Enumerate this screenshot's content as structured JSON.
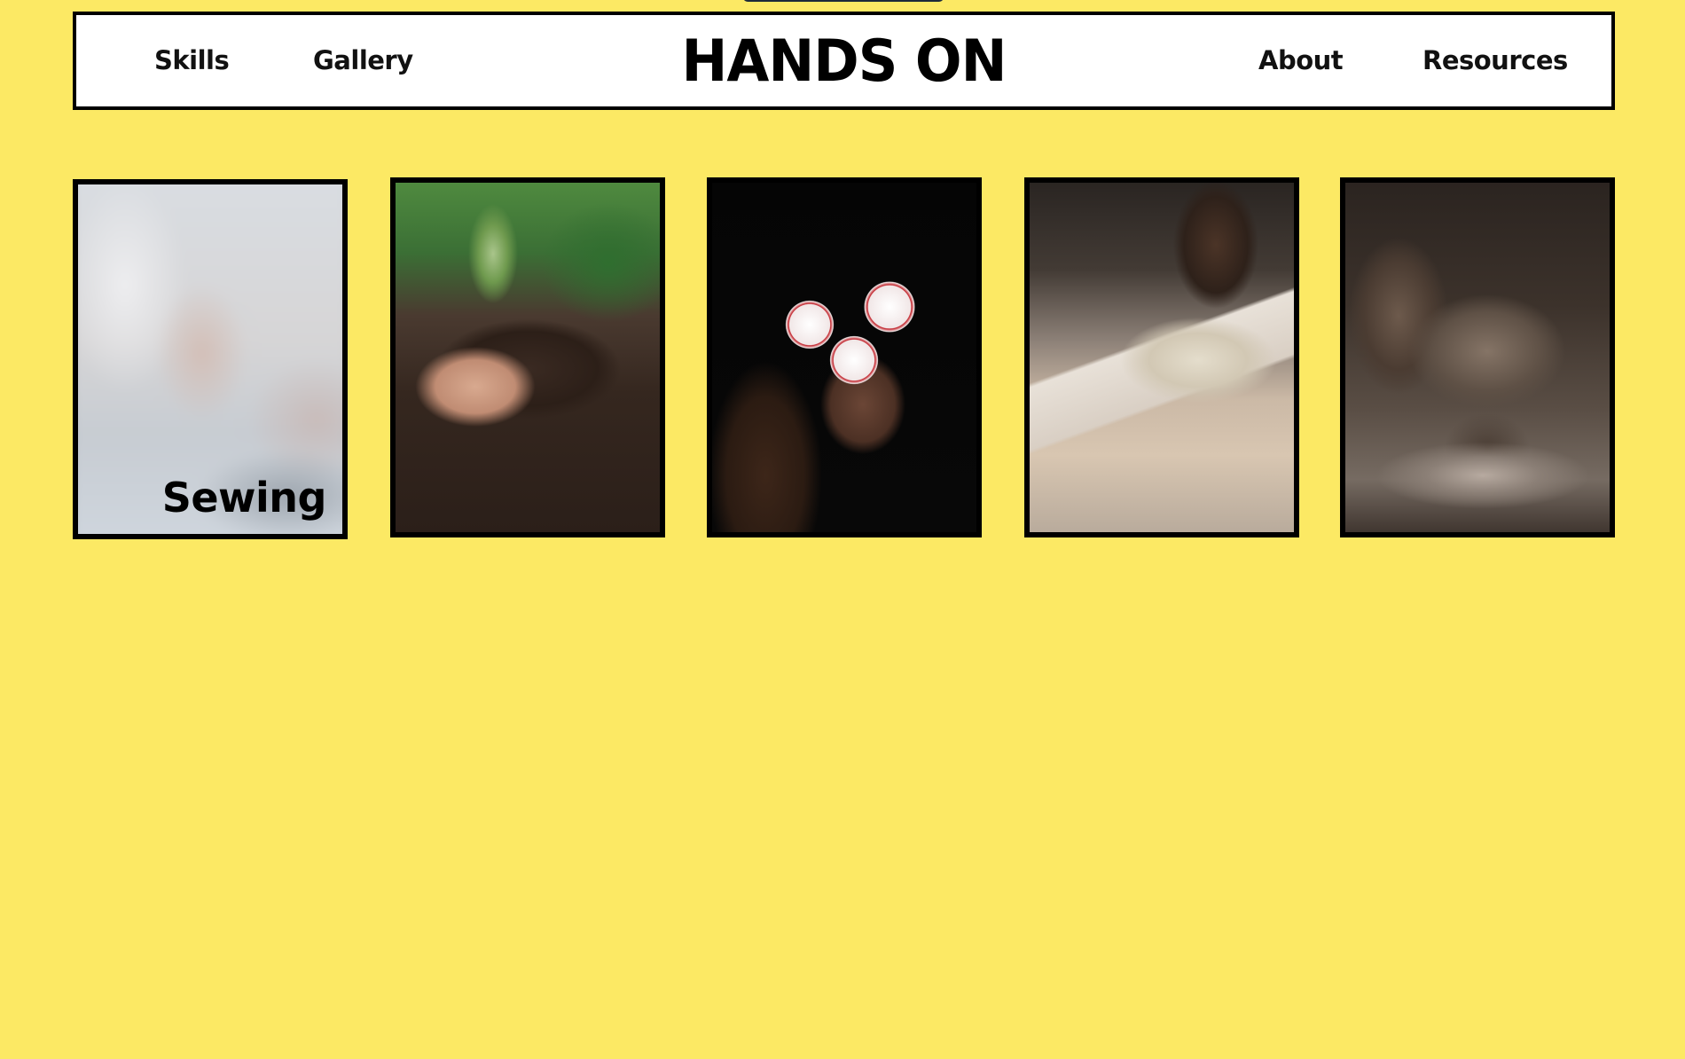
{
  "brand": {
    "title": "HANDS ON"
  },
  "nav": {
    "left": [
      {
        "label": "Skills"
      },
      {
        "label": "Gallery"
      }
    ],
    "right": [
      {
        "label": "About"
      },
      {
        "label": "Resources"
      }
    ]
  },
  "colors": {
    "background": "#fce964",
    "navbar_bg": "#ffffff",
    "border": "#000000",
    "top_tab": "#1d2a3a"
  },
  "cards": [
    {
      "label": "Sewing",
      "image": "blurred-sewing-photo",
      "state": "hovered"
    },
    {
      "label": "",
      "image": "hands-holding-soil-with-seedling-photo"
    },
    {
      "label": "",
      "image": "hand-juggling-red-white-balls-photo"
    },
    {
      "label": "",
      "image": "gloved-hands-sanding-wood-photo"
    },
    {
      "label": "",
      "image": "hands-shaping-clay-pot-on-wheel-photo"
    }
  ]
}
